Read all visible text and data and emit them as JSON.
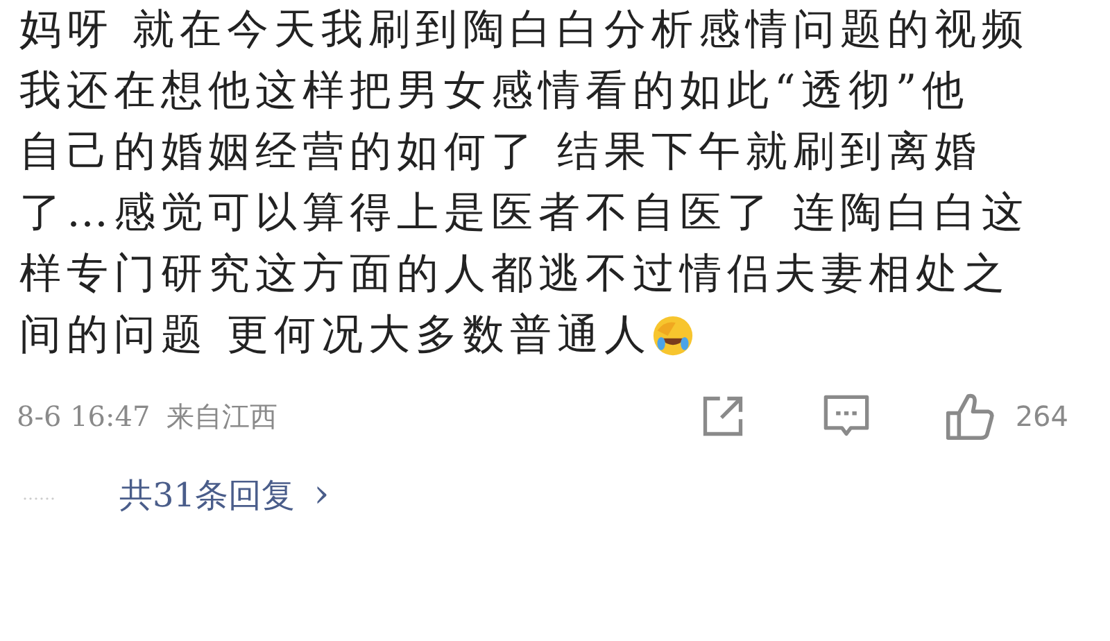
{
  "comment": {
    "lines": [
      "妈呀 就在今天我刷到陶白白分析感情问题的视频",
      "我还在想他这样把男女感情看的如此“透彻”他",
      "自己的婚姻经营的如何了 结果下午就刷到离婚",
      "了…感觉可以算得上是医者不自医了 连陶白白这",
      "样专门研究这方面的人都逃不过情侣夫妻相处之",
      "间的问题 更何况大多数普通人"
    ],
    "time": "8-6 16:47",
    "source": "来自江西",
    "likes": "264"
  },
  "replies": {
    "dots": "……",
    "label": "共31条回复",
    "arrow": "›"
  }
}
